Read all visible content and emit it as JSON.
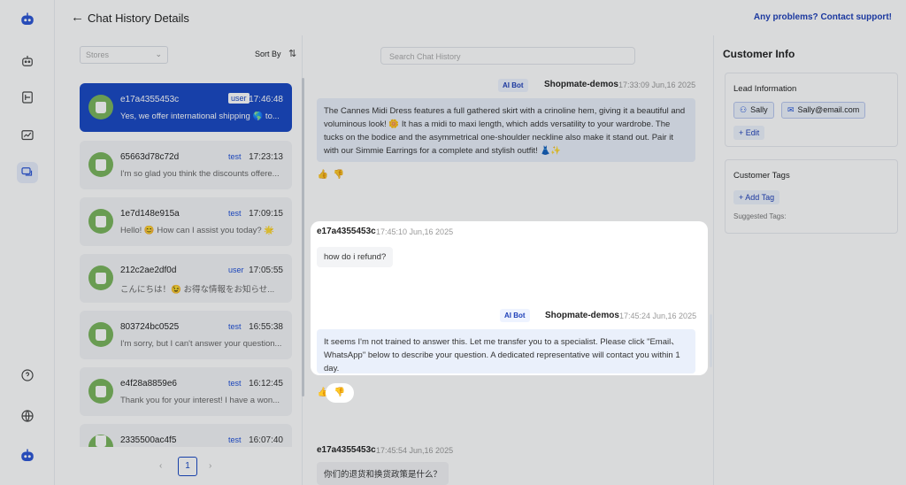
{
  "header": {
    "back_icon": "←",
    "title": "Chat History Details",
    "support_link": "Any problems? Contact support!"
  },
  "nav": {
    "items": [
      "logo-icon",
      "robot-icon",
      "document-icon",
      "chart-icon",
      "chat-icon"
    ],
    "bottom": [
      "help-icon",
      "globe-icon",
      "robot-avatar-icon"
    ]
  },
  "list": {
    "stores_placeholder": "Stores",
    "sort_label": "Sort By",
    "sort_icon": "⇅",
    "sessions": [
      {
        "id": "e17a4355453c",
        "tag": "user",
        "time": "17:46:48",
        "preview": "Yes, we offer international shipping 🌎 to..."
      },
      {
        "id": "65663d78c72d",
        "tag": "test",
        "time": "17:23:13",
        "preview": "I'm so glad you think the discounts offere..."
      },
      {
        "id": "1e7d148e915a",
        "tag": "test",
        "time": "17:09:15",
        "preview": "Hello! 😊 How can I assist you today? 🌟"
      },
      {
        "id": "212c2ae2df0d",
        "tag": "user",
        "time": "17:05:55",
        "preview": "こんにちは！😉 お得な情報をお知らせ..."
      },
      {
        "id": "803724bc0525",
        "tag": "test",
        "time": "16:55:38",
        "preview": "I'm sorry, but I can't answer your question..."
      },
      {
        "id": "e4f28a8859e6",
        "tag": "test",
        "time": "16:12:45",
        "preview": "Thank you for your interest! I have a won..."
      },
      {
        "id": "2335500ac4f5",
        "tag": "test",
        "time": "16:07:40",
        "preview": ""
      }
    ],
    "pager": {
      "prev": "‹",
      "page": "1",
      "next": "›"
    }
  },
  "chat": {
    "search_placeholder": "Search Chat History",
    "ai_badge": "AI Bot",
    "messages": [
      {
        "sender": "Shopmate-demos",
        "time": "17:33:09 Jun,16 2025",
        "text": "The Cannes Midi Dress features a full gathered skirt with a crinoline hem, giving it a beautiful and voluminous look! 🌼 It has a midi to maxi length, which adds versatility to your wardrobe. The tucks on the bodice and the asymmetrical one-shoulder neckline also make it stand out. Pair it with our Simmie Earrings for a complete and stylish outfit! 👗✨"
      },
      {
        "sender": "e17a4355453c",
        "time": "17:45:10 Jun,16 2025",
        "text": "how do i refund?"
      },
      {
        "sender": "Shopmate-demos",
        "time": "17:45:24 Jun,16 2025",
        "text": "It seems I'm not trained to answer this. Let me transfer you to a specialist. Please click \"Email、WhatsApp\" below to describe your question. A dedicated representative will contact you within 1 day."
      },
      {
        "sender": "e17a4355453c",
        "time": "17:45:54 Jun,16 2025",
        "text": "你们的退货和换货政策是什么？"
      }
    ]
  },
  "info": {
    "title": "Customer Info",
    "lead_title": "Lead Information",
    "name": "Sally",
    "email": "Sally@email.com",
    "edit_label": "+ Edit",
    "tags_title": "Customer Tags",
    "add_tag_label": "+ Add Tag",
    "suggested_label": "Suggested Tags:"
  }
}
